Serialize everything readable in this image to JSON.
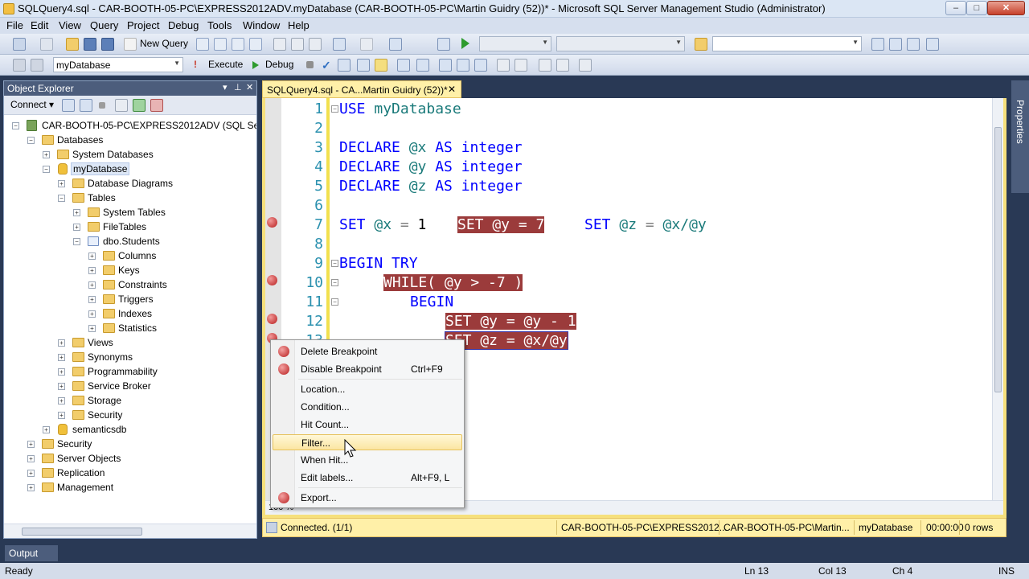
{
  "window": {
    "title": "SQLQuery4.sql - CAR-BOOTH-05-PC\\EXPRESS2012ADV.myDatabase (CAR-BOOTH-05-PC\\Martin Guidry (52))* - Microsoft SQL Server Management Studio (Administrator)",
    "minimize": "–",
    "maximize": "□",
    "close": "✕"
  },
  "menu": [
    "File",
    "Edit",
    "View",
    "Query",
    "Project",
    "Debug",
    "Tools",
    "Window",
    "Help"
  ],
  "toolbar": {
    "new_query": "New Query",
    "database_select": "myDatabase",
    "execute": "Execute",
    "debug": "Debug"
  },
  "object_explorer": {
    "title": "Object Explorer",
    "connect": "Connect",
    "tree": [
      "CAR-BOOTH-05-PC\\EXPRESS2012ADV (SQL Server",
      "Databases",
      "System Databases",
      "myDatabase",
      "Database Diagrams",
      "Tables",
      "System Tables",
      "FileTables",
      "dbo.Students",
      "Columns",
      "Keys",
      "Constraints",
      "Triggers",
      "Indexes",
      "Statistics",
      "Views",
      "Synonyms",
      "Programmability",
      "Service Broker",
      "Storage",
      "Security",
      "semanticsdb",
      "Security",
      "Server Objects",
      "Replication",
      "Management"
    ]
  },
  "editor": {
    "tab_label": "SQLQuery4.sql - CA...Martin Guidry (52))*",
    "tab_close": "✕",
    "line_numbers": [
      "1",
      "2",
      "3",
      "4",
      "5",
      "6",
      "7",
      "8",
      "9",
      "10",
      "11",
      "12",
      "13"
    ],
    "lines": {
      "l1a": "USE",
      "l1b": " myDatabase",
      "l3a": "DECLARE",
      "l3b": " @x",
      "l3c": " AS integer",
      "l4a": "DECLARE",
      "l4b": " @y",
      "l4c": " AS integer",
      "l5a": "DECLARE",
      "l5b": " @z",
      "l5c": " AS integer",
      "l7a": "SET",
      "l7b": " @x",
      "l7c": " =",
      "l7d": " 1",
      "l7e": "SET @y = 7",
      "l7f": "SET",
      "l7g": " @z",
      "l7h": " =",
      "l7i": " @x/@y",
      "l9": "BEGIN TRY",
      "l10": "WHILE( @y > -7 )",
      "l11": "BEGIN",
      "l12": "SET @y = @y - 1",
      "l13": "SET @z = @x/@y"
    },
    "zoom": "100 %"
  },
  "context_menu": {
    "items": [
      {
        "label": "Delete Breakpoint",
        "shortcut": ""
      },
      {
        "label": "Disable Breakpoint",
        "shortcut": "Ctrl+F9"
      },
      {
        "label": "Location...",
        "shortcut": ""
      },
      {
        "label": "Condition...",
        "shortcut": ""
      },
      {
        "label": "Hit Count...",
        "shortcut": ""
      },
      {
        "label": "Filter...",
        "shortcut": ""
      },
      {
        "label": "When Hit...",
        "shortcut": ""
      },
      {
        "label": "Edit labels...",
        "shortcut": "Alt+F9, L"
      },
      {
        "label": "Export...",
        "shortcut": ""
      }
    ]
  },
  "query_status": {
    "connection": "Connected. (1/1)",
    "server": "CAR-BOOTH-05-PC\\EXPRESS2012...",
    "user": "CAR-BOOTH-05-PC\\Martin...",
    "database": "myDatabase",
    "time": "00:00:00",
    "rows": "0 rows"
  },
  "properties_rail": "Properties",
  "output_tab": "Output",
  "statusbar": {
    "state": "Ready",
    "ln": "Ln 13",
    "col": "Col 13",
    "ch": "Ch 4",
    "ins": "INS"
  },
  "colors": {
    "breakpoint_bg": "#9b3b3b",
    "keyword": "#0000ff",
    "variable": "#1a7a7a",
    "tab_active": "#fff0a8"
  }
}
